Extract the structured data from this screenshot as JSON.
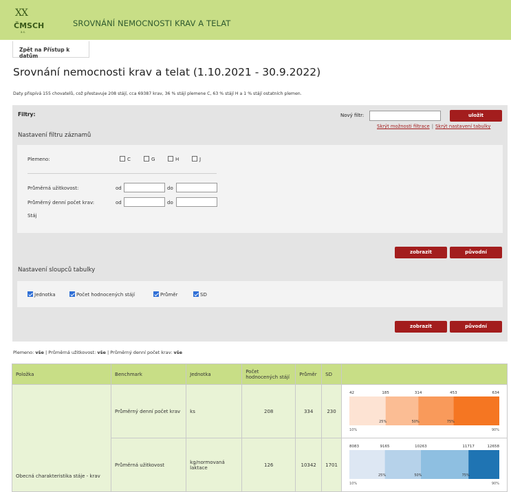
{
  "header": {
    "logo_mark": "XX",
    "logo_text": "ČMSCH",
    "logo_sub": "a.s.",
    "title": "SROVNÁNÍ NEMOCNOSTI KRAV A TELAT"
  },
  "nav": {
    "back_label": "Zpět na Přístup k datům"
  },
  "page": {
    "title": "Srovnání nemocnosti krav a telat (1.10.2021 - 30.9.2022)",
    "info": "Daty přispívá 155 chovatelů, což přestavuje 208 stájí, cca 69387 krav, 36 % stájí plemene C, 63 % stájí H a 1 % stájí ostatních plemen."
  },
  "filters": {
    "label": "Filtry:",
    "new_filter_label": "Nový filtr:",
    "new_filter_value": "",
    "save_label": "uložit",
    "hide_filter_link": "Skrýt možnosti filtrace",
    "separator": "|",
    "hide_table_link": "Skrýt nastavení tabulky",
    "records_title": "Nastavení filtru záznamů",
    "breed_label": "Plemeno:",
    "breeds": [
      "C",
      "G",
      "H",
      "J"
    ],
    "avg_yield_label": "Průměrná užitkovost:",
    "avg_cows_label": "Průměrný denní počet krav:",
    "stable_label": "Stáj",
    "from_label": "od",
    "to_label": "do",
    "show_label": "zobrazit",
    "original_label": "původní",
    "columns_title": "Nastavení sloupců tabulky",
    "columns": [
      "Jednotka",
      "Počet hodnocených stájí",
      "Průměr",
      "SD"
    ]
  },
  "summary": {
    "breed_label": "Plemeno:",
    "breed_value": "vše",
    "yield_label": "Průměrná užitkovost:",
    "yield_value": "vše",
    "cows_label": "Průměrný denní počet krav:",
    "cows_value": "vše",
    "separator": "|"
  },
  "table": {
    "headers": [
      "Položka",
      "Benchmark",
      "Jednotka",
      "Počet hodnocených stájí",
      "Průměr",
      "SD",
      ""
    ],
    "group_label": "Obecná charakteristika stáje - krav",
    "rows": [
      {
        "benchmark": "Průměrný denní počet krav",
        "unit": "ks",
        "count": "208",
        "mean": "334",
        "sd": "230",
        "scale": {
          "values": [
            "42",
            "185",
            "314",
            "453",
            "634"
          ],
          "percentiles": [
            "10%",
            "25%",
            "50%",
            "75%",
            "90%"
          ],
          "colors": [
            "#fde3d3",
            "#fbbd94",
            "#f99a5b",
            "#f57622"
          ]
        }
      },
      {
        "benchmark": "Průměrná užitkovost",
        "unit": "kg/normovaná laktace",
        "count": "126",
        "mean": "10342",
        "sd": "1701",
        "scale": {
          "values": [
            "8083",
            "9165",
            "10263",
            "11717",
            "12658"
          ],
          "percentiles": [
            "10%",
            "25%",
            "50%",
            "75%",
            "90%"
          ],
          "colors": [
            "#dde7f3",
            "#b6d2ea",
            "#8ebfe1",
            "#1f74b3"
          ]
        }
      }
    ]
  }
}
